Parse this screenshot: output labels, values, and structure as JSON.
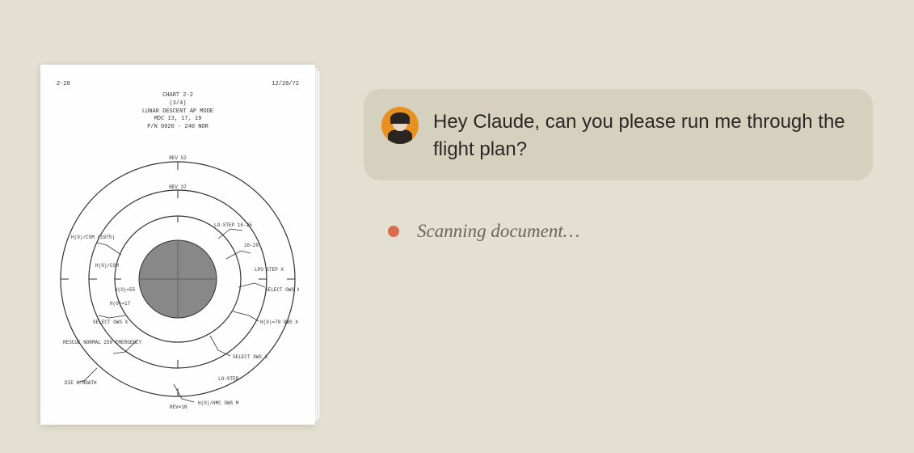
{
  "document": {
    "header_left": "2-28",
    "header_right": "12/20/72",
    "title_line1": "CHART 2-2",
    "title_line2": "(3/4)",
    "title_line3": "LUNAR DESCENT AP MODE",
    "title_line4": "MDC 13, 17, 19",
    "title_line5": "P/N 0020 - 240 NOR",
    "chart_labels": {
      "top": "REV 52",
      "top_inner": "REV 37",
      "left_outer_top": "H(0)/CSM (1975)",
      "left_mid": "H(0)/CSM",
      "left_inner": "H(0)=55",
      "left_inner2": "H(0)=17",
      "center_top": "LO-STEP 16-25",
      "center_right": "16-28",
      "right_upper": "LPO STEP X",
      "right_mid": "SELECT OWS X",
      "right_lower": "H(0)=78 OWS X",
      "right_bottom": "SELECT OWS X",
      "bottom_left": "DIE H/MDATH",
      "bottom_center": "REV=1N",
      "bottom_right": "H(0)/HMC OWS M",
      "bottom_label": "LO-STEP",
      "l_outer": "RESCUE NORMAL 250 EMERGENCY",
      "l_inner": "SELECT OWS X"
    }
  },
  "chat": {
    "user_message": "Hey Claude, can you please run me through the flight plan?",
    "status_text": "Scanning document…"
  },
  "colors": {
    "background": "#e4e0d1",
    "bubble": "#d6d1bf",
    "status_dot": "#d96b4f",
    "avatar_bg": "#e89020"
  }
}
